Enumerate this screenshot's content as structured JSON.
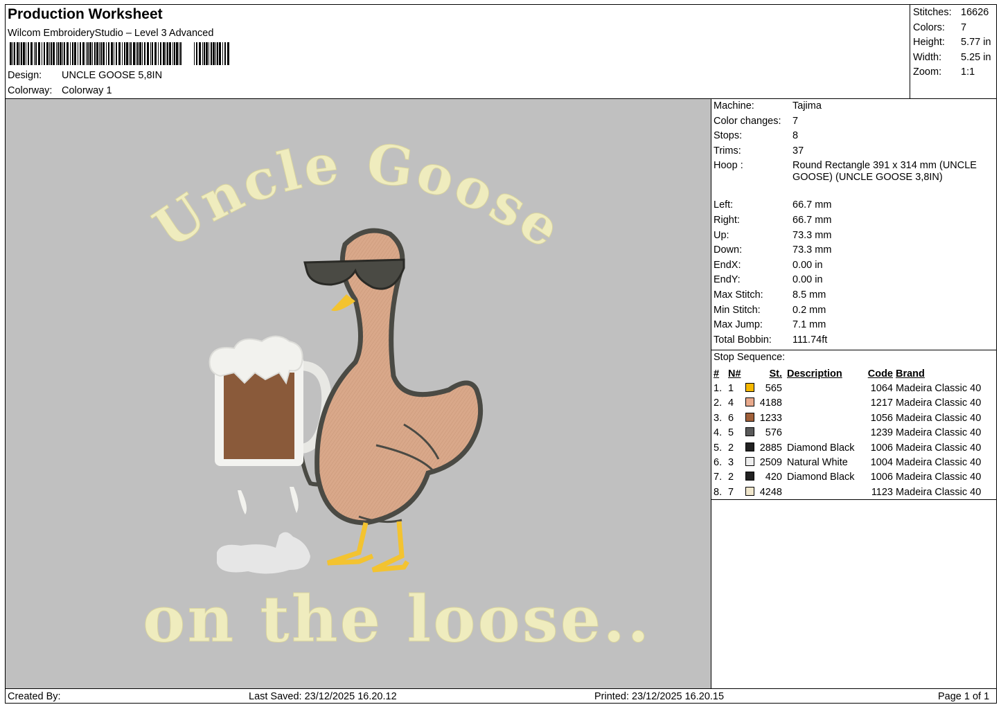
{
  "header": {
    "title": "Production Worksheet",
    "software": "Wilcom EmbroideryStudio – Level 3 Advanced",
    "design_label": "Design:",
    "design_value": "UNCLE GOOSE 5,8IN",
    "colorway_label": "Colorway:",
    "colorway_value": "Colorway 1"
  },
  "summary": [
    {
      "label": "Stitches:",
      "value": "16626"
    },
    {
      "label": "Colors:",
      "value": "7"
    },
    {
      "label": "Height:",
      "value": "5.77 in"
    },
    {
      "label": "Width:",
      "value": "5.25 in"
    },
    {
      "label": "Zoom:",
      "value": "1:1"
    }
  ],
  "design_text": {
    "top": "Uncle Goose",
    "bottom": "on the loose.."
  },
  "machine_info": [
    {
      "label": "Machine:",
      "value": "Tajima"
    },
    {
      "label": "Color changes:",
      "value": "7"
    },
    {
      "label": "Stops:",
      "value": "8"
    },
    {
      "label": "Trims:",
      "value": "37"
    },
    {
      "label": "Hoop :",
      "value": "Round Rectangle 391 x 314 mm (UNCLE GOOSE) (UNCLE GOOSE 3,8IN)"
    },
    {
      "label": "Left:",
      "value": "66.7 mm"
    },
    {
      "label": "Right:",
      "value": "66.7 mm"
    },
    {
      "label": "Up:",
      "value": "73.3 mm"
    },
    {
      "label": "Down:",
      "value": "73.3 mm"
    },
    {
      "label": "EndX:",
      "value": "0.00 in"
    },
    {
      "label": "EndY:",
      "value": "0.00 in"
    },
    {
      "label": "Max Stitch:",
      "value": "8.5 mm"
    },
    {
      "label": "Min Stitch:",
      "value": "0.2 mm"
    },
    {
      "label": "Max Jump:",
      "value": "7.1 mm"
    },
    {
      "label": "Total Bobbin:",
      "value": "111.74ft"
    }
  ],
  "stop_sequence": {
    "caption": "Stop Sequence:",
    "headers": {
      "num": "#",
      "n": "N#",
      "st": "St.",
      "description": "Description",
      "code": "Code",
      "brand": "Brand"
    },
    "rows": [
      {
        "num": "1.",
        "n": "1",
        "color": "#f5b800",
        "st": "565",
        "description": "",
        "code": "1064",
        "brand": "Madeira Classic 40"
      },
      {
        "num": "2.",
        "n": "4",
        "color": "#e8a98c",
        "st": "4188",
        "description": "",
        "code": "1217",
        "brand": "Madeira Classic 40"
      },
      {
        "num": "3.",
        "n": "6",
        "color": "#a0603a",
        "st": "1233",
        "description": "",
        "code": "1056",
        "brand": "Madeira Classic 40"
      },
      {
        "num": "4.",
        "n": "5",
        "color": "#5a5a5a",
        "st": "576",
        "description": "",
        "code": "1239",
        "brand": "Madeira Classic 40"
      },
      {
        "num": "5.",
        "n": "2",
        "color": "#222222",
        "st": "2885",
        "description": "Diamond Black",
        "code": "1006",
        "brand": "Madeira Classic 40"
      },
      {
        "num": "6.",
        "n": "3",
        "color": "#eeeeee",
        "st": "2509",
        "description": "Natural White",
        "code": "1004",
        "brand": "Madeira Classic 40"
      },
      {
        "num": "7.",
        "n": "2",
        "color": "#222222",
        "st": "420",
        "description": "Diamond Black",
        "code": "1006",
        "brand": "Madeira Classic 40"
      },
      {
        "num": "8.",
        "n": "7",
        "color": "#f0e6cc",
        "st": "4248",
        "description": "",
        "code": "1123",
        "brand": "Madeira Classic 40"
      }
    ]
  },
  "footer": {
    "created_by": "Created By:",
    "last_saved": "Last Saved: 23/12/2025 16.20.12",
    "printed": "Printed: 23/12/2025 16.20.15",
    "page": "Page 1 of 1"
  },
  "colors": {
    "design_background": "#c0c0c0",
    "text_thread": "#efecbe",
    "goose_body": "#d9a88a",
    "beer": "#8a5a3a"
  }
}
